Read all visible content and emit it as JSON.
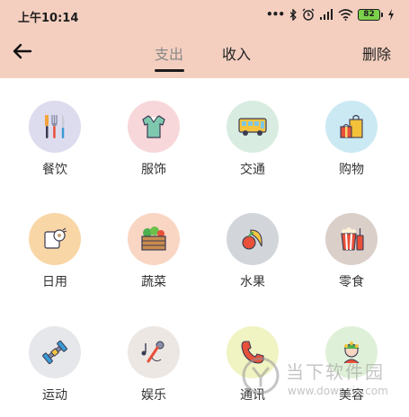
{
  "status_bar": {
    "time": "上午10:14",
    "battery": "82"
  },
  "nav": {
    "tabs": [
      {
        "label": "支出",
        "active": true
      },
      {
        "label": "收入",
        "active": false
      }
    ],
    "delete_label": "删除"
  },
  "categories": [
    {
      "label": "餐饮",
      "icon": "utensils-icon",
      "bg": "#dcdcee"
    },
    {
      "label": "服饰",
      "icon": "shirt-icon",
      "bg": "#f7d7da"
    },
    {
      "label": "交通",
      "icon": "bus-icon",
      "bg": "#d8ece1"
    },
    {
      "label": "购物",
      "icon": "shopping-bag-icon",
      "bg": "#cbe9f3"
    },
    {
      "label": "日用",
      "icon": "toilet-paper-icon",
      "bg": "#f9d6a6"
    },
    {
      "label": "蔬菜",
      "icon": "vegetable-crate-icon",
      "bg": "#f9d6c4"
    },
    {
      "label": "水果",
      "icon": "fruit-icon",
      "bg": "#d2d6db"
    },
    {
      "label": "零食",
      "icon": "snack-icon",
      "bg": "#dacfc9"
    },
    {
      "label": "运动",
      "icon": "dumbbell-icon",
      "bg": "#e6e7ea"
    },
    {
      "label": "娱乐",
      "icon": "music-icon",
      "bg": "#ece7e3"
    },
    {
      "label": "通讯",
      "icon": "phone-icon",
      "bg": "#f0f3c2"
    },
    {
      "label": "美容",
      "icon": "beauty-icon",
      "bg": "#dff0d8"
    }
  ],
  "watermark": {
    "text": "当下软件园",
    "url": "www.downxia.com"
  }
}
